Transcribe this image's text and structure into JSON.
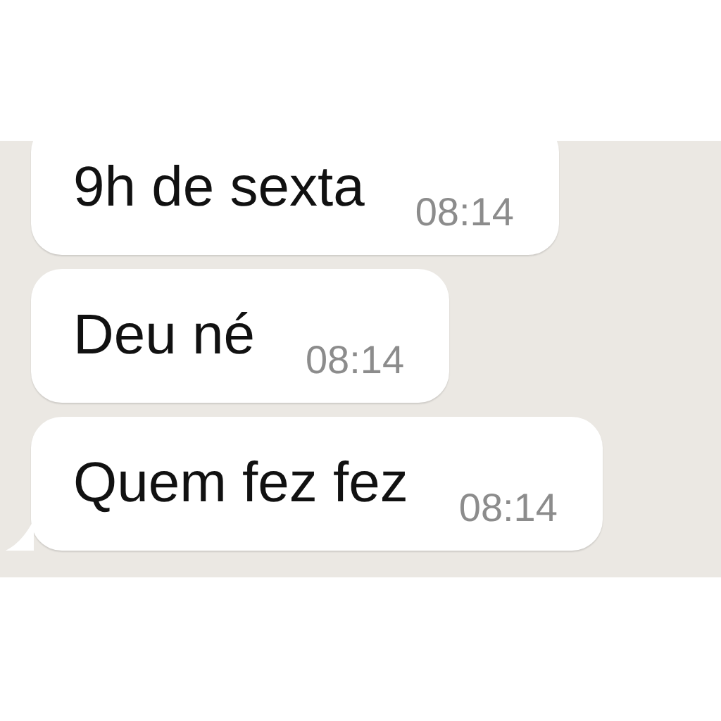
{
  "messages": [
    {
      "text": "9h de sexta",
      "time": "08:14",
      "tail": false
    },
    {
      "text": "Deu né",
      "time": "08:14",
      "tail": false
    },
    {
      "text": "Quem fez fez",
      "time": "08:14",
      "tail": true
    }
  ]
}
